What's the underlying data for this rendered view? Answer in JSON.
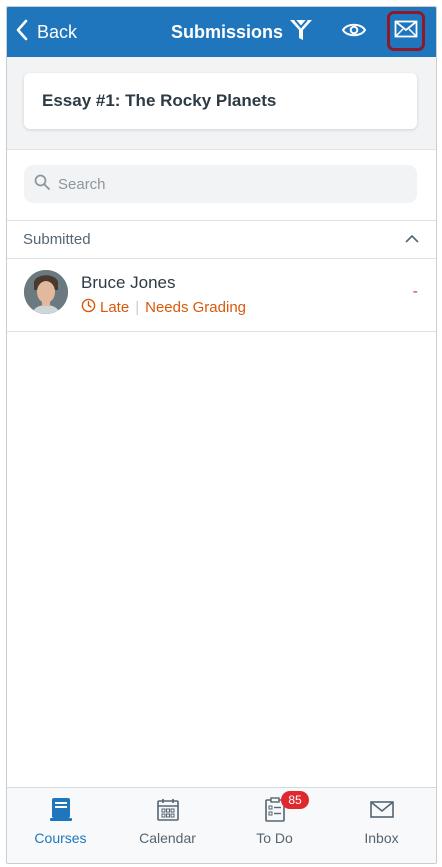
{
  "header": {
    "back_label": "Back",
    "title": "Submissions",
    "icons": [
      "filter-icon",
      "eye-icon",
      "mail-icon"
    ],
    "highlight_color": "#8b1a2b",
    "bg_color": "#1f76bd"
  },
  "assignment": {
    "title": "Essay #1: The Rocky Planets"
  },
  "search": {
    "placeholder": "Search"
  },
  "section": {
    "label": "Submitted"
  },
  "submissions": [
    {
      "name": "Bruce Jones",
      "status_late": "Late",
      "status_grading": "Needs Grading",
      "grade": "-"
    }
  ],
  "tabs": [
    {
      "label": "Courses",
      "icon": "courses-icon",
      "active": true
    },
    {
      "label": "Calendar",
      "icon": "calendar-icon",
      "active": false
    },
    {
      "label": "To Do",
      "icon": "todo-icon",
      "active": false,
      "badge": "85"
    },
    {
      "label": "Inbox",
      "icon": "inbox-icon",
      "active": false
    }
  ]
}
